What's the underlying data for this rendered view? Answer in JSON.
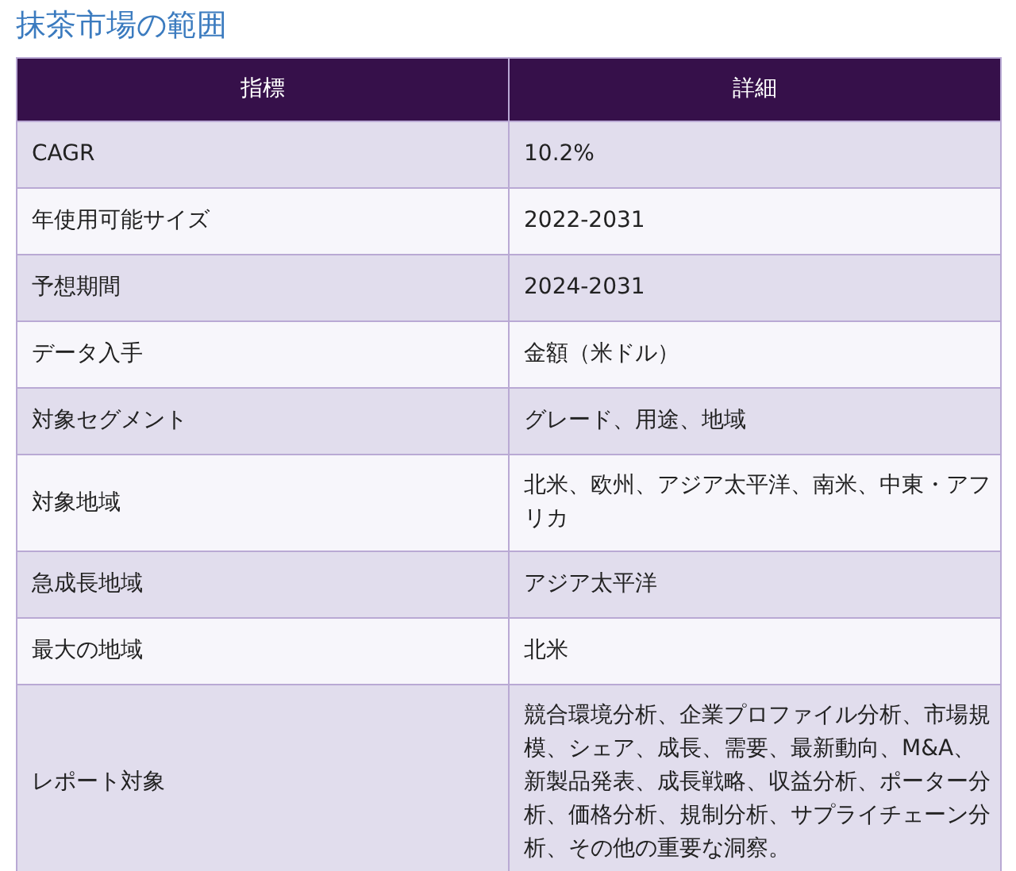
{
  "title": "抹茶市場の範囲",
  "table": {
    "columns": [
      "指標",
      "詳細"
    ],
    "rows": [
      {
        "label": "CAGR",
        "value": "10.2%"
      },
      {
        "label": "年使用可能サイズ",
        "value": "2022-2031"
      },
      {
        "label": "予想期間",
        "value": "2024-2031"
      },
      {
        "label": "データ入手",
        "value": "金額（米ドル）"
      },
      {
        "label": "対象セグメント",
        "value": "グレード、用途、地域"
      },
      {
        "label": "対象地域",
        "value": "北米、欧州、アジア太平洋、南米、中東・アフリカ"
      },
      {
        "label": "急成長地域",
        "value": "アジア太平洋"
      },
      {
        "label": "最大の地域",
        "value": "北米"
      },
      {
        "label": "レポート対象",
        "value": "競合環境分析、企業プロファイル分析、市場規模、シェア、成長、需要、最新動向、M&A、新製品発表、成長戦略、収益分析、ポーター分析、価格分析、規制分析、サプライチェーン分析、その他の重要な洞察。"
      }
    ]
  }
}
